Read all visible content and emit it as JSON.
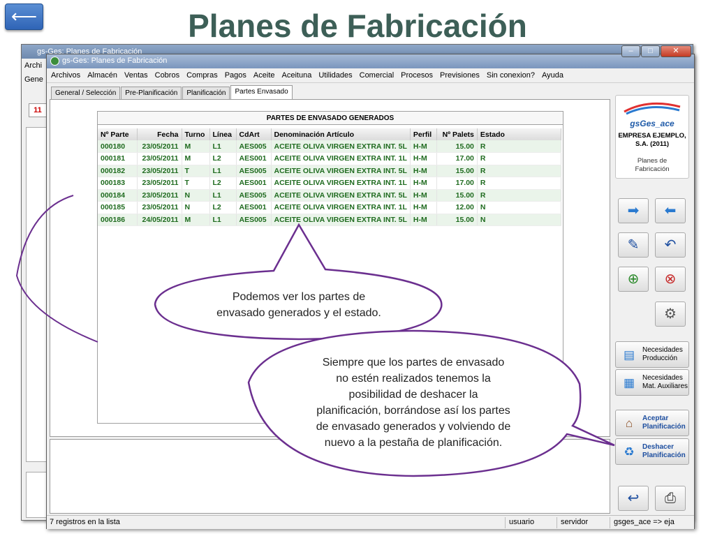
{
  "slide": {
    "title": "Planes de Fabricación",
    "back_symbol": "⟵"
  },
  "background_window": {
    "title": "gs-Ges: Planes de Fabricación",
    "menu_partial": "Archi",
    "tab_partial": "Gene",
    "cell_value": "11"
  },
  "window": {
    "title": "gs-Ges: Planes de Fabricación",
    "menu": [
      "Archivos",
      "Almacén",
      "Ventas",
      "Cobros",
      "Compras",
      "Pagos",
      "Aceite",
      "Aceituna",
      "Utilidades",
      "Comercial",
      "Procesos",
      "Previsiones",
      "Sin conexion?",
      "Ayuda"
    ],
    "tabs": [
      "General / Selección",
      "Pre-Planificación",
      "Planificación",
      "Partes Envasado"
    ],
    "active_tab": "Partes Envasado"
  },
  "table": {
    "caption": "PARTES DE ENVASADO GENERADOS",
    "columns": [
      "Nº Parte",
      "Fecha",
      "Turno",
      "Línea",
      "CdArt",
      "Denominación Artículo",
      "Perfil",
      "Nº Palets",
      "Estado"
    ],
    "rows": [
      [
        "000180",
        "23/05/2011",
        "M",
        "L1",
        "AES005",
        "ACEITE OLIVA VIRGEN EXTRA INT. 5L",
        "H-M",
        "15.00",
        "R"
      ],
      [
        "000181",
        "23/05/2011",
        "M",
        "L2",
        "AES001",
        "ACEITE OLIVA VIRGEN EXTRA INT. 1L",
        "H-M",
        "17.00",
        "R"
      ],
      [
        "000182",
        "23/05/2011",
        "T",
        "L1",
        "AES005",
        "ACEITE OLIVA VIRGEN EXTRA INT. 5L",
        "H-M",
        "15.00",
        "R"
      ],
      [
        "000183",
        "23/05/2011",
        "T",
        "L2",
        "AES001",
        "ACEITE OLIVA VIRGEN EXTRA INT. 1L",
        "H-M",
        "17.00",
        "R"
      ],
      [
        "000184",
        "23/05/2011",
        "N",
        "L1",
        "AES005",
        "ACEITE OLIVA VIRGEN EXTRA INT. 5L",
        "H-M",
        "15.00",
        "R"
      ],
      [
        "000185",
        "23/05/2011",
        "N",
        "L2",
        "AES001",
        "ACEITE OLIVA VIRGEN EXTRA INT. 1L",
        "H-M",
        "12.00",
        "N"
      ],
      [
        "000186",
        "24/05/2011",
        "M",
        "L1",
        "AES005",
        "ACEITE OLIVA VIRGEN EXTRA INT. 5L",
        "H-M",
        "15.00",
        "N"
      ]
    ]
  },
  "logo": {
    "brand": "gsGes_ace",
    "company_line1": "EMPRESA EJEMPLO,",
    "company_line2": "S.A. (2011)",
    "plan_line1": "Planes de",
    "plan_line2": "Fabricación"
  },
  "icons": {
    "next": "arrow-right-icon",
    "prev": "arrow-left-icon",
    "edit": "pen-document-icon",
    "restore": "document-undo-icon",
    "db_add": "database-add-icon",
    "db_delete": "database-delete-icon",
    "tool": "wrench-icon",
    "exit": "return-icon",
    "print": "printer-icon"
  },
  "side_buttons": {
    "necesidades_prod": [
      "Necesidades",
      "Producción"
    ],
    "necesidades_aux": [
      "Necesidades",
      "Mat. Auxiliares"
    ],
    "aceptar": [
      "Aceptar",
      "Planificación"
    ],
    "deshacer": [
      "Deshacer",
      "Planificación"
    ]
  },
  "status": {
    "records": "7 registros en la lista",
    "user": "usuario",
    "server": "servidor",
    "db": "gsges_ace => eja"
  },
  "callouts": {
    "first": [
      "Podemos ver los partes de",
      "envasado generados y el estado."
    ],
    "second": [
      "Siempre que los partes de envasado",
      "no estén realizados tenemos la",
      "posibilidad de deshacer la",
      "planificación, borrándose así los partes",
      "de envasado generados y  volviendo de",
      "nuevo a la pestaña de planificación."
    ]
  },
  "colors": {
    "title": "#3d5f57",
    "row_text": "#1f6b1f",
    "bubble_border": "#6b2f8f"
  }
}
